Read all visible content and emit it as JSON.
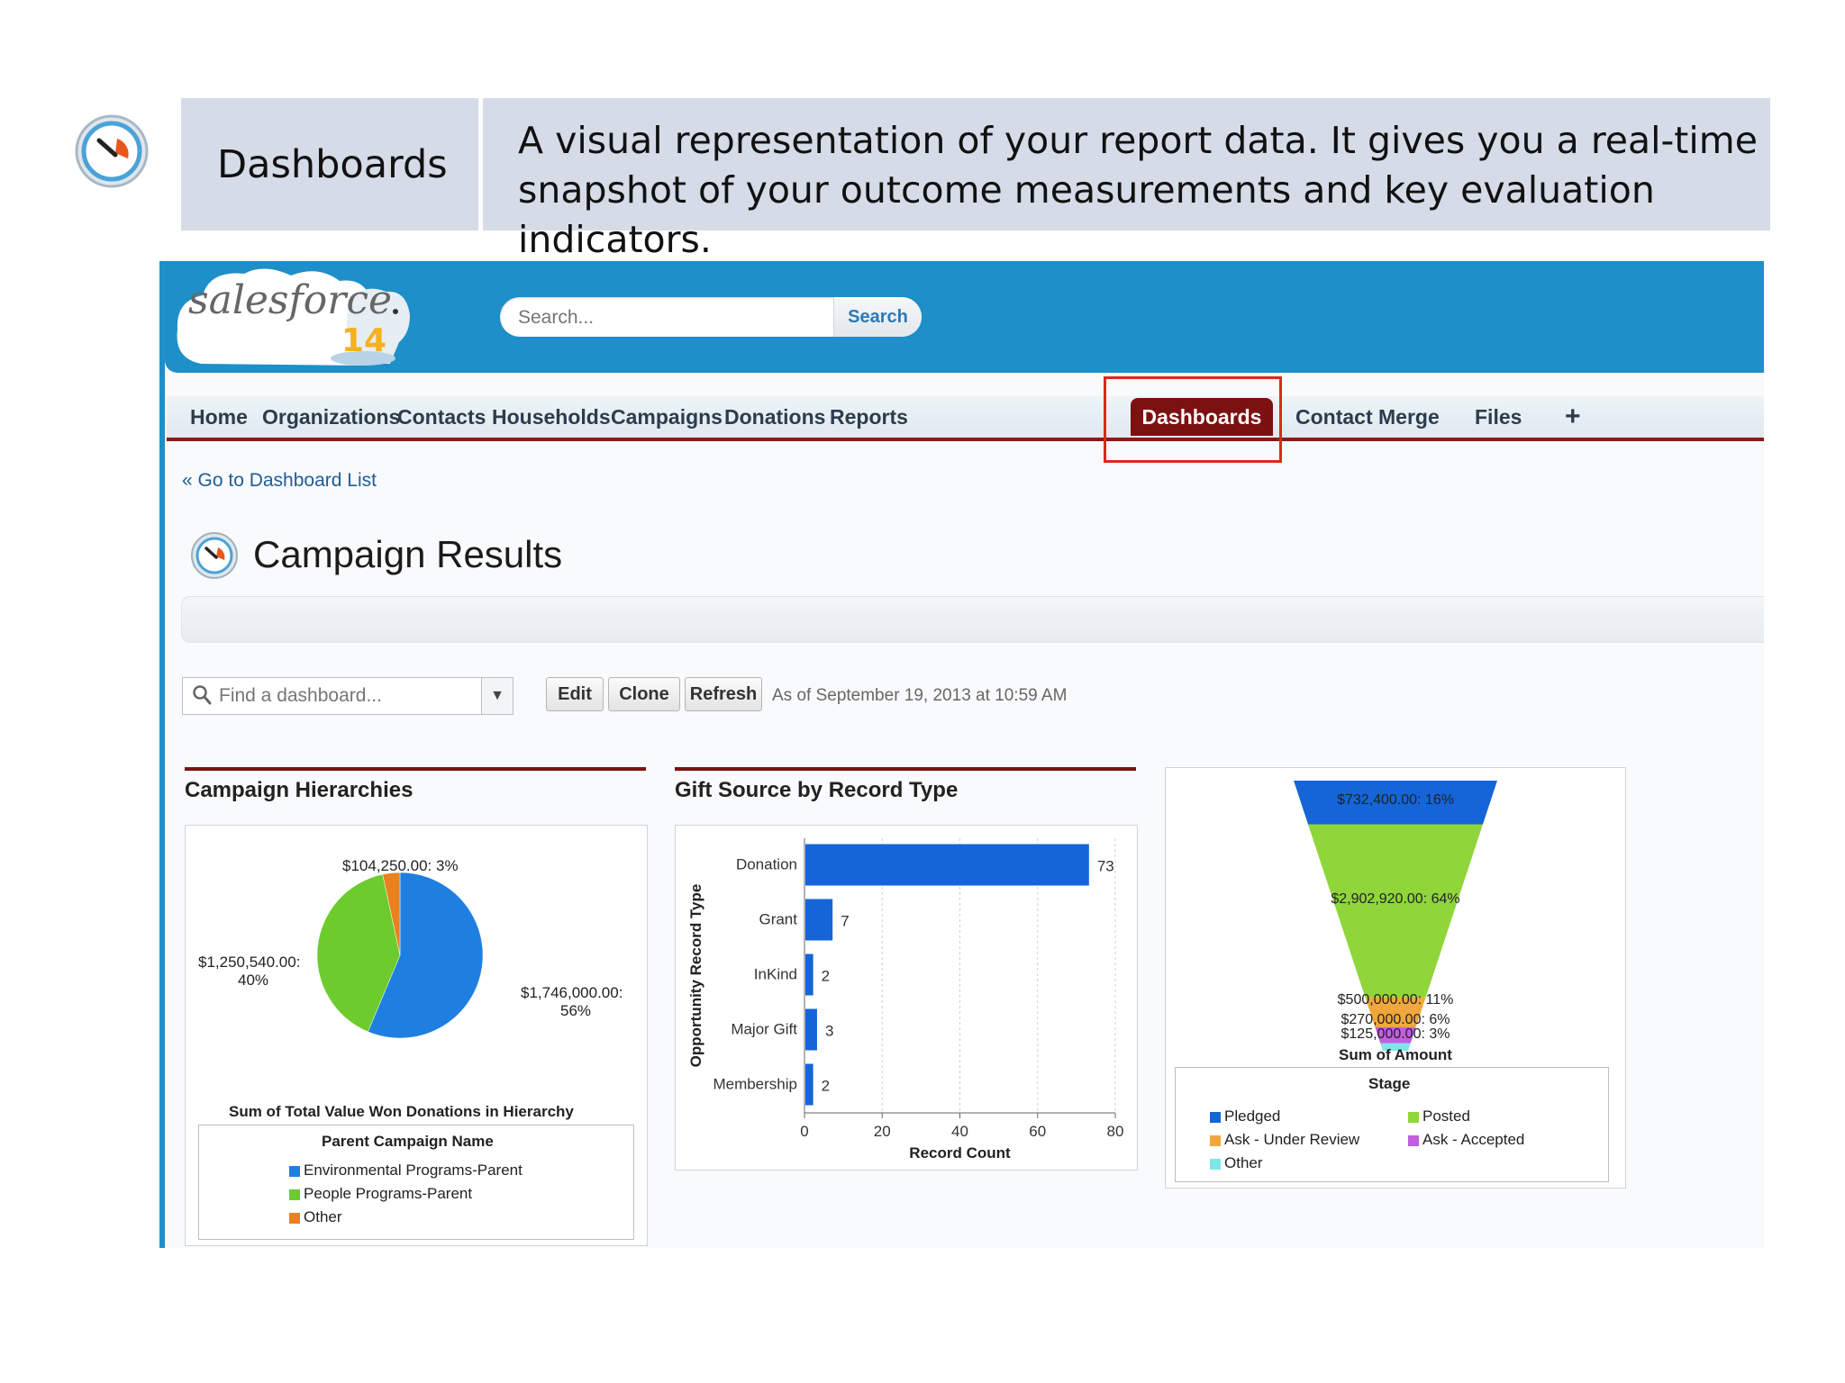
{
  "banner": {
    "title": "Dashboards",
    "description": "A visual representation of your report data. It gives you a real-time snapshot of your outcome measurements and key evaluation indicators."
  },
  "app": {
    "logo_text": "salesforce",
    "logo_version": "14",
    "search": {
      "placeholder": "Search...",
      "button": "Search"
    }
  },
  "nav": {
    "items": [
      "Home",
      "Organizations",
      "Contacts",
      "Households",
      "Campaigns",
      "Donations",
      "Reports",
      "Dashboards",
      "Contact Merge",
      "Files"
    ],
    "active": "Dashboards",
    "plus": "+"
  },
  "breadcrumb": "« Go to Dashboard List",
  "page": {
    "title": "Campaign Results"
  },
  "toolbar": {
    "find_placeholder": "Find a dashboard...",
    "edit": "Edit",
    "clone": "Clone",
    "refresh": "Refresh",
    "as_of": "As of September 19, 2013 at 10:59 AM"
  },
  "colors": {
    "brand_blue": "#1e8fc8",
    "nav_active": "#7b1111",
    "highlight": "#e0271a"
  },
  "chart_data": [
    {
      "type": "pie",
      "title": "Campaign Hierarchies",
      "xlabel": "Sum of Total Value Won Donations in Hierarchy",
      "legend_title": "Parent Campaign Name",
      "slices": [
        {
          "name": "Environmental Programs-Parent",
          "value": 1746000,
          "label": "$1,746,000.00:",
          "pct": "56%",
          "color": "#1e7fe0"
        },
        {
          "name": "People Programs-Parent",
          "value": 1250540,
          "label": "$1,250,540.00:",
          "pct": "40%",
          "color": "#6ccc2e"
        },
        {
          "name": "Other",
          "value": 104250,
          "label": "$104,250.00: 3%",
          "pct": "",
          "color": "#e8821e"
        }
      ]
    },
    {
      "type": "bar",
      "orientation": "horizontal",
      "title": "Gift Source by Record Type",
      "ylabel": "Opportunity Record Type",
      "xlabel": "Record Count",
      "categories": [
        "Donation",
        "Grant",
        "InKind",
        "Major Gift",
        "Membership"
      ],
      "values": [
        73,
        7,
        2,
        3,
        2
      ],
      "xlim": [
        0,
        80
      ],
      "xticks": [
        "0",
        "20",
        "40",
        "60",
        "80"
      ],
      "color": "#1565d8"
    },
    {
      "type": "funnel",
      "xlabel": "Sum of Amount",
      "legend_title": "Stage",
      "segments": [
        {
          "name": "Pledged",
          "label": "$732,400.00: 16%",
          "value": 732400,
          "color": "#1565d8"
        },
        {
          "name": "Posted",
          "label": "$2,902,920.00: 64%",
          "value": 2902920,
          "color": "#8ed63a"
        },
        {
          "name": "Ask - Under Review",
          "label": "$500,000.00: 11%",
          "value": 500000,
          "color": "#f0a83c"
        },
        {
          "name": "Ask - Accepted",
          "label": "$270,000.00: 6%",
          "value": 270000,
          "color": "#c25ee0"
        },
        {
          "name": "Other",
          "label": "$125,000.00: 3%",
          "value": 125000,
          "color": "#7fe6e6"
        }
      ],
      "legend": [
        "Pledged",
        "Posted",
        "Ask - Under Review",
        "Ask - Accepted",
        "Other"
      ]
    }
  ]
}
